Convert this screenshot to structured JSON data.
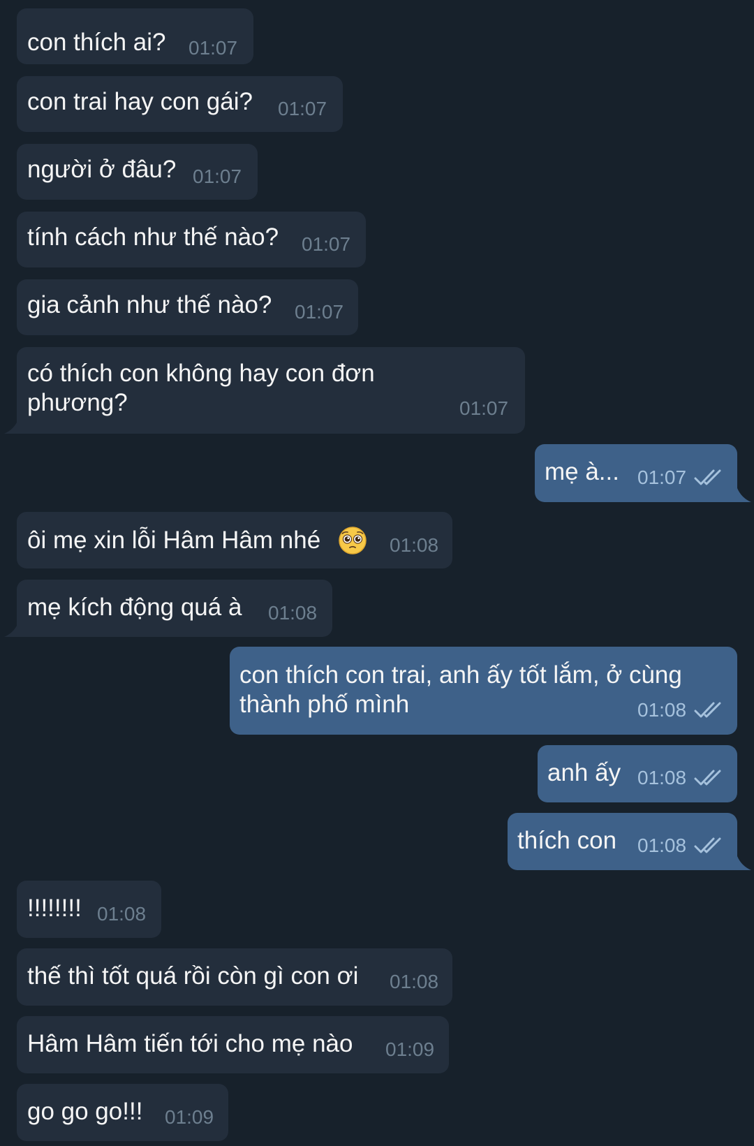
{
  "colors": {
    "background": "#17212b",
    "incoming_bubble": "#232e3c",
    "outgoing_bubble": "#3e6189",
    "text": "#f5f5f5",
    "incoming_time": "#6d7f8f",
    "outgoing_time": "#a6c2dd"
  },
  "messages": [
    {
      "dir": "in",
      "text": "con thích ai?",
      "time": "01:07"
    },
    {
      "dir": "in",
      "text": "con trai hay con gái?",
      "time": "01:07"
    },
    {
      "dir": "in",
      "text": "người ở đâu?",
      "time": "01:07"
    },
    {
      "dir": "in",
      "text": "tính cách như thế nào?",
      "time": "01:07"
    },
    {
      "dir": "in",
      "text": "gia cảnh như thế nào?",
      "time": "01:07"
    },
    {
      "dir": "in",
      "text_line1": "có thích con không hay con đơn",
      "text_line2": "phương?",
      "time": "01:07"
    },
    {
      "dir": "out",
      "text": "mẹ à...",
      "time": "01:07",
      "read": true
    },
    {
      "dir": "in",
      "text": "ôi mẹ xin lỗi Hâm Hâm nhé",
      "emoji": "pleading-face-emoji",
      "time": "01:08"
    },
    {
      "dir": "in",
      "text": "mẹ kích động quá à",
      "time": "01:08"
    },
    {
      "dir": "out",
      "text_line1": "con thích con trai, anh ấy tốt lắm, ở cùng",
      "text_line2": "thành phố mình",
      "time": "01:08",
      "read": true
    },
    {
      "dir": "out",
      "text": "anh ấy",
      "time": "01:08",
      "read": true
    },
    {
      "dir": "out",
      "text": "thích con",
      "time": "01:08",
      "read": true
    },
    {
      "dir": "in",
      "text": "!!!!!!!!",
      "time": "01:08"
    },
    {
      "dir": "in",
      "text": "thế thì tốt quá rồi còn gì con ơi",
      "time": "01:08"
    },
    {
      "dir": "in",
      "text": "Hâm Hâm tiến tới cho mẹ nào",
      "time": "01:09"
    },
    {
      "dir": "in",
      "text": "go go go!!!",
      "time": "01:09"
    }
  ]
}
